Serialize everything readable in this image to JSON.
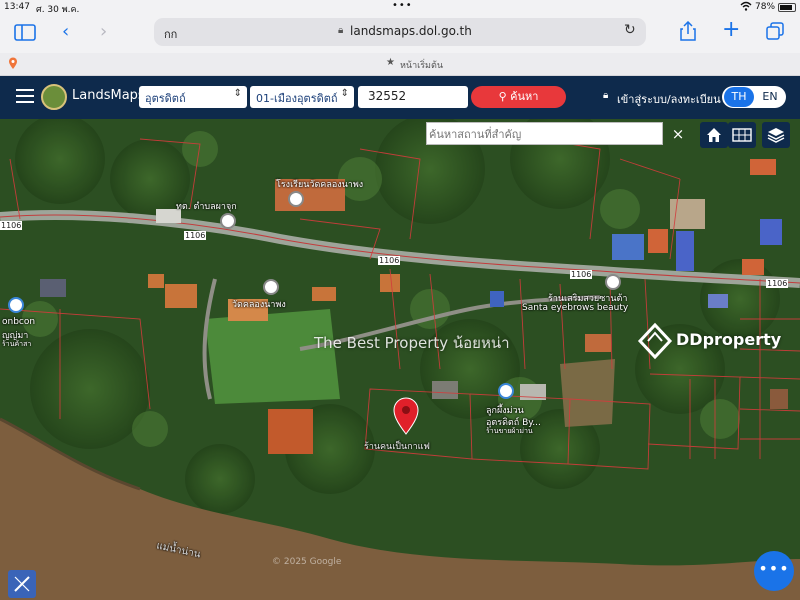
{
  "status": {
    "time": "13:47",
    "date": "ศ. 30 พ.ค.",
    "battery": "78%"
  },
  "browser": {
    "tab_label": "กก",
    "url": "landsmaps.dol.go.th",
    "bookmark_label": "หน้าเริ่มต้น"
  },
  "app": {
    "name": "LandsMaps",
    "province": "อุตรดิตถ์",
    "district": "01-เมืองอุตรดิตถ์",
    "parcel_no": "32552",
    "search_label": "ค้นหา",
    "login_label": "เข้าสู่ระบบ/ลงทะเบียน",
    "lang_th": "TH",
    "lang_en": "EN"
  },
  "map": {
    "place_search_placeholder": "ค้นหาสถานที่สำคัญ",
    "clear_symbol": "×",
    "road_labels": [
      "1106",
      "1106",
      "1106",
      "1106",
      "1106"
    ],
    "places": {
      "school": "โรงเรียนวัดคลองนาพง",
      "tessaban": "ทต. ตำบลผาจุก",
      "temple": "วัดคลองนาพง",
      "beauty_th": "ร้านเสริมสวยซานต้า",
      "beauty_en": "Santa eyebrows beauty",
      "shop_left_1": "onbcon",
      "shop_left_2": "ญญ่มา",
      "shop_left_3": "ร้านค้าสา",
      "cafe_1": "ลูกผึ้งม่วน",
      "cafe_2": "อุตรดิตถ์ By...",
      "cafe_3": "ร้านขายผ้าม่าน",
      "pin_label": "ร้านคนเป็นกาแฟ",
      "river": "แม่น้ำน่าน"
    },
    "watermark_text": "The Best Property น้อยหน่า",
    "brand": "DDproperty",
    "copyright": "© 2025 Google"
  }
}
